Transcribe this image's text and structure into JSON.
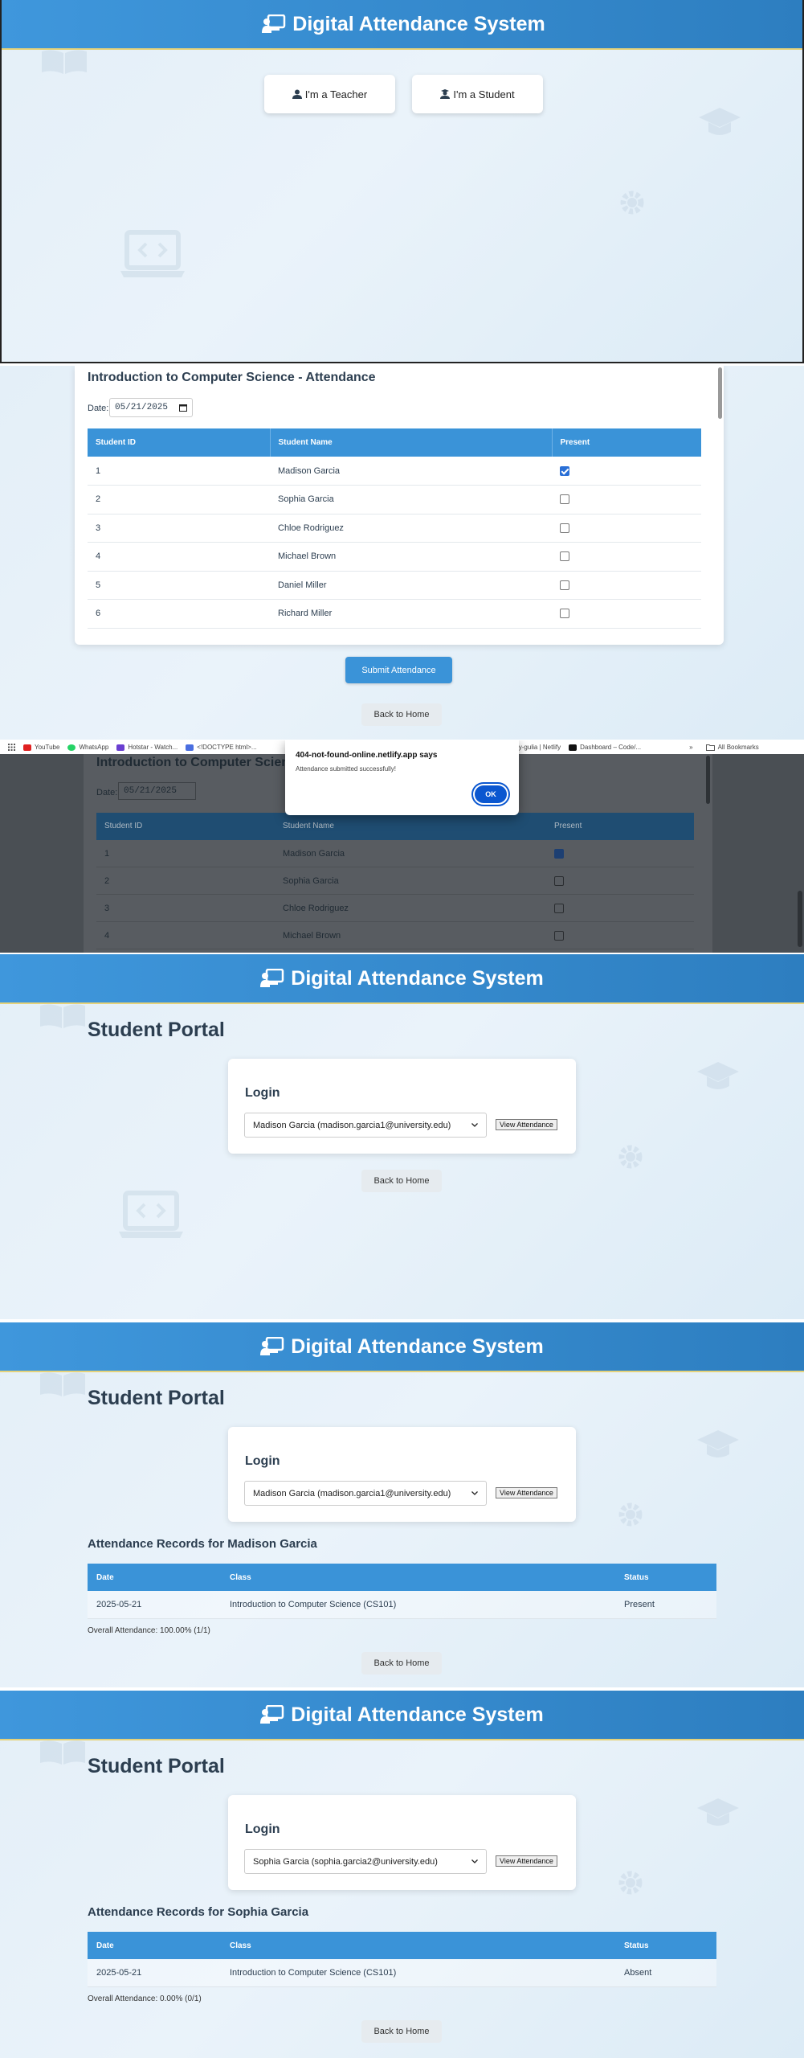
{
  "app": {
    "title": "Digital Attendance System"
  },
  "home": {
    "teacher_btn": "I'm a Teacher",
    "student_btn": "I'm a Student"
  },
  "teacher": {
    "class_title": "Introduction to Computer Science - Attendance",
    "date_label": "Date:",
    "date_value": "05/21/2025",
    "columns": [
      "Student ID",
      "Student Name",
      "Present"
    ],
    "rows": [
      {
        "id": "1",
        "name": "Madison Garcia",
        "present": true
      },
      {
        "id": "2",
        "name": "Sophia Garcia",
        "present": false
      },
      {
        "id": "3",
        "name": "Chloe Rodriguez",
        "present": false
      },
      {
        "id": "4",
        "name": "Michael Brown",
        "present": false
      },
      {
        "id": "5",
        "name": "Daniel Miller",
        "present": false
      },
      {
        "id": "6",
        "name": "Richard Miller",
        "present": false
      }
    ],
    "submit_label": "Submit Attendance",
    "back_label": "Back to Home"
  },
  "browser": {
    "bookmarks": [
      {
        "label": "YouTube",
        "color": "#e02020"
      },
      {
        "label": "WhatsApp",
        "color": "#25d366"
      },
      {
        "label": "Hotstar - Watch...",
        "color": "#6a3fd1"
      },
      {
        "label": "<!DOCTYPE html>...",
        "color": "#4a6ee0"
      }
    ],
    "bookmarks_right": [
      {
        "label": "tanmay-gulia | Netlify",
        "color": "#2fb4b4"
      },
      {
        "label": "Dashboard – Code/...",
        "color": "#111111"
      }
    ],
    "more": "»",
    "all_bookmarks": "All Bookmarks"
  },
  "alert": {
    "site": "404-not-found-online.netlify.app says",
    "message": "Attendance submitted successfully!",
    "ok": "OK"
  },
  "student": {
    "portal_title": "Student Portal",
    "login_title": "Login",
    "view_btn": "View Attendance",
    "back_label": "Back to Home",
    "record_columns": [
      "Date",
      "Class",
      "Status"
    ],
    "screens": [
      {
        "selected": "Madison Garcia (madison.garcia1@university.edu)"
      },
      {
        "selected": "Madison Garcia (madison.garcia1@university.edu)",
        "records_title": "Attendance Records for Madison Garcia",
        "records": [
          {
            "date": "2025-05-21",
            "class": "Introduction to Computer Science (CS101)",
            "status": "Present"
          }
        ],
        "overall": "Overall Attendance: 100.00% (1/1)"
      },
      {
        "selected": "Sophia Garcia (sophia.garcia2@university.edu)",
        "records_title": "Attendance Records for Sophia Garcia",
        "records": [
          {
            "date": "2025-05-21",
            "class": "Introduction to Computer Science (CS101)",
            "status": "Absent"
          }
        ],
        "overall": "Overall Attendance: 0.00% (0/1)"
      }
    ]
  }
}
